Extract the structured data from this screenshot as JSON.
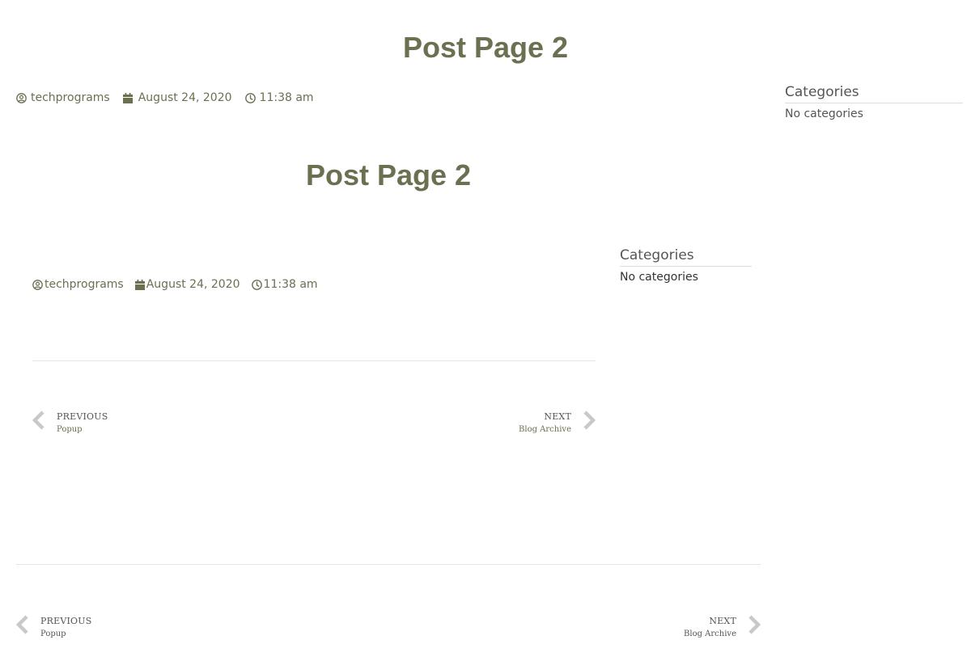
{
  "colors": {
    "accent": "#6a7050",
    "chevron": "#c9c9c9",
    "rule": "#e4e4e4"
  },
  "outer": {
    "post_title": "Post Page 2",
    "meta": {
      "author": "techprograms",
      "date": "August 24, 2020",
      "time": "11:38 am"
    },
    "sidebar": {
      "widget_title": "Categories",
      "widget_body": "No categories"
    },
    "post_nav": {
      "previous_label": "PREVIOUS",
      "previous_title": "Popup",
      "next_label": "NEXT",
      "next_title": "Blog Archive"
    }
  },
  "inner": {
    "post_title": "Post Page 2",
    "meta": {
      "author": "techprograms",
      "date": "August 24, 2020",
      "time": "11:38 am"
    },
    "sidebar": {
      "widget_title": "Categories",
      "widget_body": "No categories"
    },
    "post_nav": {
      "previous_label": "PREVIOUS",
      "previous_title": "Popup",
      "next_label": "NEXT",
      "next_title": "Blog Archive"
    }
  },
  "icons": {
    "author": "user-circle-icon",
    "date": "calendar-icon",
    "time": "clock-icon",
    "previous": "chevron-left-icon",
    "next": "chevron-right-icon"
  }
}
